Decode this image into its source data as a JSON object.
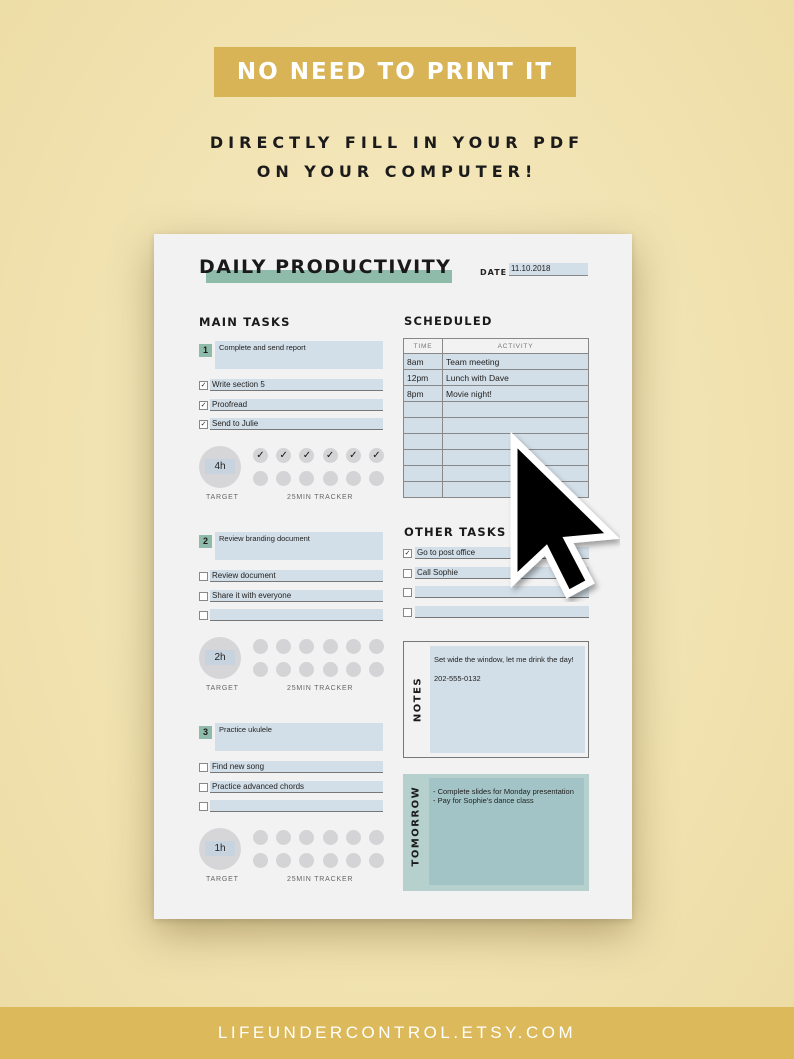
{
  "promo": {
    "banner": "NO NEED TO PRINT IT",
    "subtitle_line1": "DIRECTLY FILL IN YOUR PDF",
    "subtitle_line2": "ON YOUR COMPUTER!",
    "footer": "LIFEUNDERCONTROL.ETSY.COM"
  },
  "planner": {
    "title": "DAILY PRODUCTIVITY",
    "date_label": "DATE",
    "date_value": "11.10.2018",
    "main_tasks_heading": "MAIN TASKS",
    "target_label": "TARGET",
    "tracker_label": "25MIN TRACKER",
    "main_tasks": [
      {
        "number": "1",
        "title": "Complete and send report",
        "subtasks": [
          {
            "text": "Write section 5",
            "checked": true
          },
          {
            "text": "Proofread",
            "checked": true
          },
          {
            "text": "Send to Julie",
            "checked": true
          }
        ],
        "target": "4h",
        "tracker_done": 6,
        "tracker_total": 12
      },
      {
        "number": "2",
        "title": "Review branding document",
        "subtasks": [
          {
            "text": "Review document",
            "checked": false
          },
          {
            "text": "Share it with everyone",
            "checked": false
          },
          {
            "text": "",
            "checked": false
          }
        ],
        "target": "2h",
        "tracker_done": 0,
        "tracker_total": 12
      },
      {
        "number": "3",
        "title": "Practice ukulele",
        "subtasks": [
          {
            "text": "Find new song",
            "checked": false
          },
          {
            "text": "Practice advanced chords",
            "checked": false
          },
          {
            "text": "",
            "checked": false
          }
        ],
        "target": "1h",
        "tracker_done": 0,
        "tracker_total": 12
      }
    ],
    "scheduled": {
      "heading": "SCHEDULED",
      "col_time": "TIME",
      "col_activity": "ACTIVITY",
      "rows": [
        {
          "time": "8am",
          "activity": "Team meeting"
        },
        {
          "time": "12pm",
          "activity": "Lunch with Dave"
        },
        {
          "time": "8pm",
          "activity": "Movie night!"
        },
        {
          "time": "",
          "activity": ""
        },
        {
          "time": "",
          "activity": ""
        },
        {
          "time": "",
          "activity": ""
        },
        {
          "time": "",
          "activity": ""
        },
        {
          "time": "",
          "activity": ""
        },
        {
          "time": "",
          "activity": ""
        }
      ]
    },
    "other_tasks": {
      "heading": "OTHER TASKS",
      "items": [
        {
          "text": "Go to post office",
          "checked": true
        },
        {
          "text": "Call Sophie",
          "checked": false
        },
        {
          "text": "",
          "checked": false
        },
        {
          "text": "",
          "checked": false
        }
      ]
    },
    "notes": {
      "label": "NOTES",
      "line1": "Set wide the window, let me drink the day!",
      "line2": "202-555-0132"
    },
    "tomorrow": {
      "label": "TOMORROW",
      "line1": "- Complete slides for Monday presentation",
      "line2": "- Pay for Sophie's dance class"
    }
  },
  "colors": {
    "gold": "#d8b457",
    "teal": "#8fbcaa",
    "field": "#d3dfe8",
    "tomorrow": "#a3c4c6"
  },
  "icons": {
    "check": "✓",
    "cursor": "mouse-pointer-arrow"
  }
}
